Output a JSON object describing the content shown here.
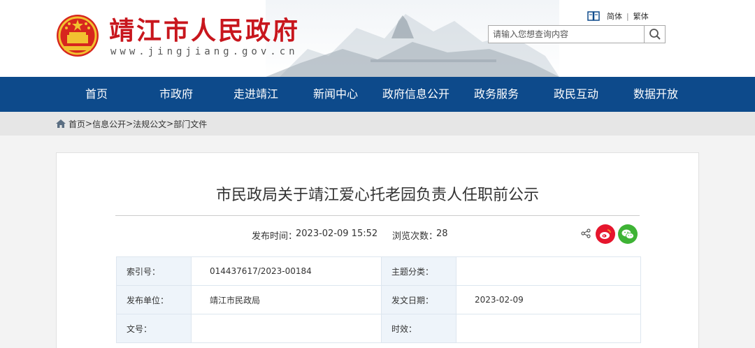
{
  "header": {
    "site_title": "靖江市人民政府",
    "site_url": "www.jingjiang.gov.cn",
    "lang_simplified": "简体",
    "lang_separator": "|",
    "lang_traditional": "繁体",
    "search_placeholder": "请输入您想查询内容"
  },
  "nav": {
    "items": [
      "首页",
      "市政府",
      "走进靖江",
      "新闻中心",
      "政府信息公开",
      "政务服务",
      "政民互动",
      "数据开放"
    ]
  },
  "breadcrumb": {
    "items": [
      "首页",
      "信息公开",
      "法规公文",
      "部门文件"
    ],
    "separator": ">"
  },
  "article": {
    "title": "市民政局关于靖江爱心托老园负责人任职前公示",
    "publish_label": "发布时间：",
    "publish_time": "2023-02-09 15:52",
    "views_label": "浏览次数：",
    "views_count": "28"
  },
  "info_table": {
    "index_label": "索引号：",
    "index_value": "014437617/2023-00184",
    "topic_label": "主题分类：",
    "topic_value": "",
    "issuer_label": "发布单位：",
    "issuer_value": "靖江市民政局",
    "date_label": "发文日期：",
    "date_value": "2023-02-09",
    "docno_label": "文号：",
    "docno_value": "",
    "validity_label": "时效：",
    "validity_value": ""
  },
  "colors": {
    "nav_bg": "#0d4a8b",
    "title_red": "#c8161d",
    "weibo_red": "#e6162d",
    "wechat_green": "#3eb335"
  }
}
